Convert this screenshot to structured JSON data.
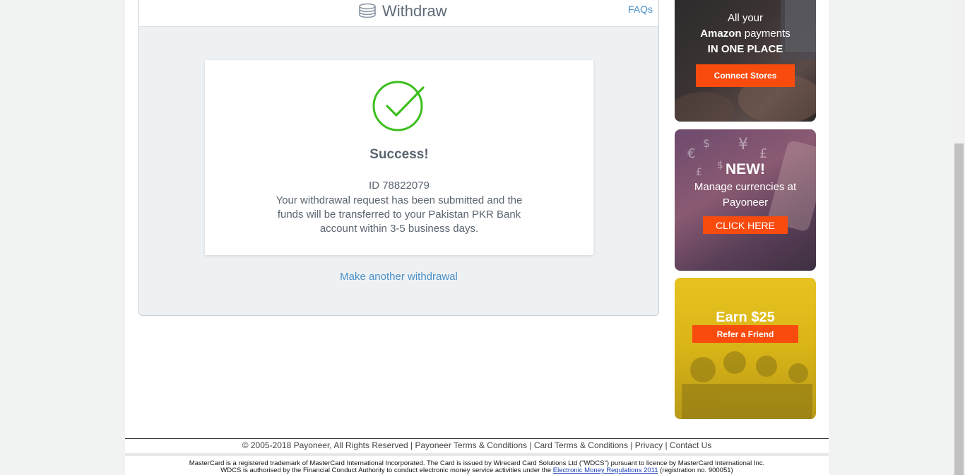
{
  "panel": {
    "title": "Withdraw",
    "faq_label": "FAQs"
  },
  "success": {
    "title": "Success!",
    "id_text": "ID 78822079",
    "message": "Your withdrawal request has been submitted and the funds will be transferred to your Pakistan PKR Bank account within 3-5 business days.",
    "another_link": "Make another withdrawal",
    "check_color": "#3dbf1f"
  },
  "ads": {
    "amazon": {
      "line1": "All your",
      "line2_bold": "Amazon",
      "line2_rest": " payments",
      "line3": "IN ONE PLACE",
      "button": "Connect Stores"
    },
    "currencies": {
      "headline": "NEW!",
      "message": "Manage currencies at Payoneer",
      "button": "CLICK HERE"
    },
    "refer": {
      "headline": "Earn $25",
      "button": "Refer a Friend"
    },
    "button_color": "#fa4b0f"
  },
  "footer": {
    "copyright": "© 2005-2018 Payoneer, All Rights Reserved",
    "links": [
      "Payoneer Terms & Conditions",
      "Card Terms & Conditions",
      "Privacy",
      "Contact Us"
    ],
    "legal_line1": "MasterCard is a registered trademark of MasterCard International Incorporated. The Card is issued by Wirecard Card Solutions Ltd (\"WDCS\") pursuant to licence by MasterCard International Inc.",
    "legal_line2_pre": "WDCS is authorised by the Financial Conduct Authority to conduct electronic money service activities under the ",
    "legal_line2_link": "Electronic Money Regulations 2011",
    "legal_line2_post": " (registration no. 900051)"
  }
}
